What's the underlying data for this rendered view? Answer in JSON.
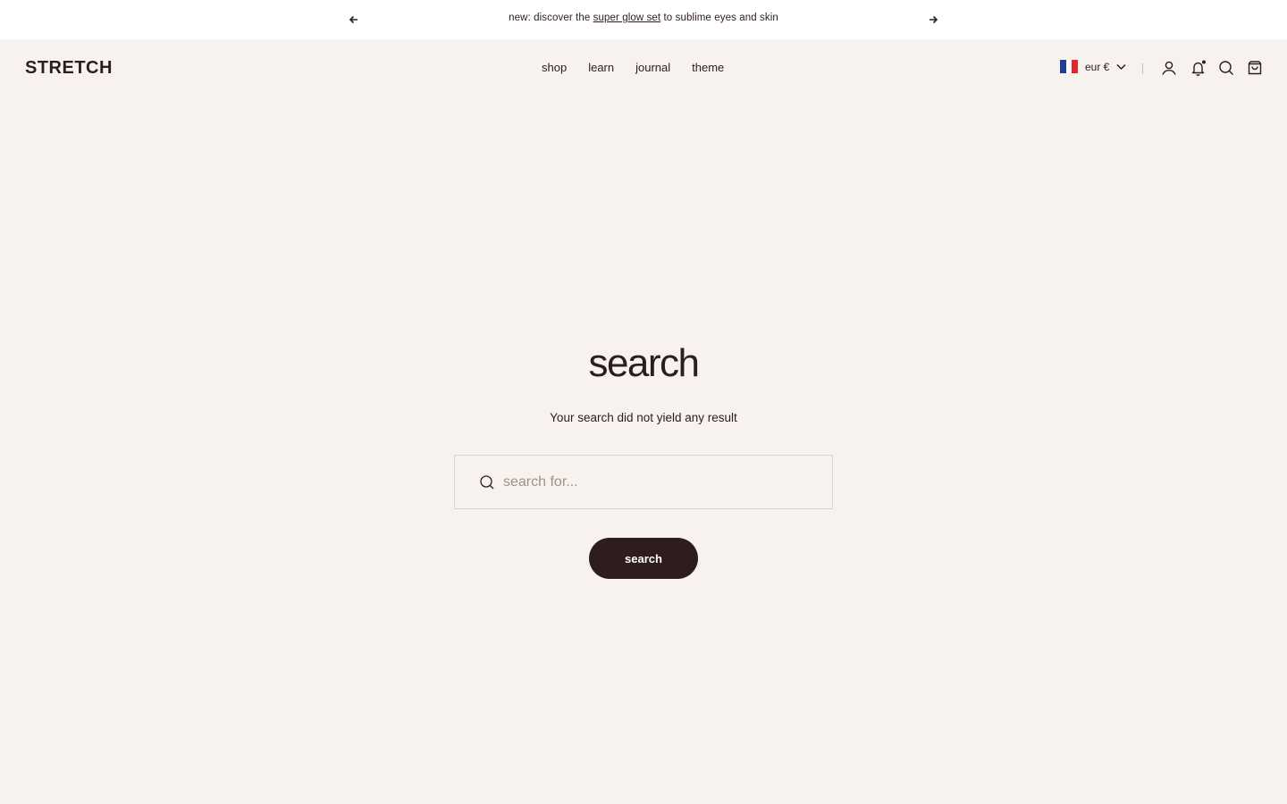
{
  "announcement": {
    "prefix": "new: discover the",
    "link": "super glow set",
    "suffix": "to sublime eyes and skin",
    "prev_icon": "arrow-left-icon",
    "next_icon": "arrow-right-icon"
  },
  "header": {
    "logo": "STRETCH",
    "nav": [
      "shop",
      "learn",
      "journal",
      "theme"
    ],
    "locale": {
      "currency": "eur €",
      "flag_colors": [
        "#1f3c96",
        "#ffffff",
        "#e1262f"
      ]
    },
    "icons": [
      "account-icon",
      "notification-bell-icon",
      "search-icon",
      "cart-icon"
    ]
  },
  "main": {
    "title": "search",
    "subtitle": "Your search did not yield any result",
    "search_placeholder": "search for...",
    "search_button": "search"
  },
  "colors": {
    "background": "#f7f2ee",
    "text": "#2d1d1d",
    "button": "#2d1d1d"
  }
}
